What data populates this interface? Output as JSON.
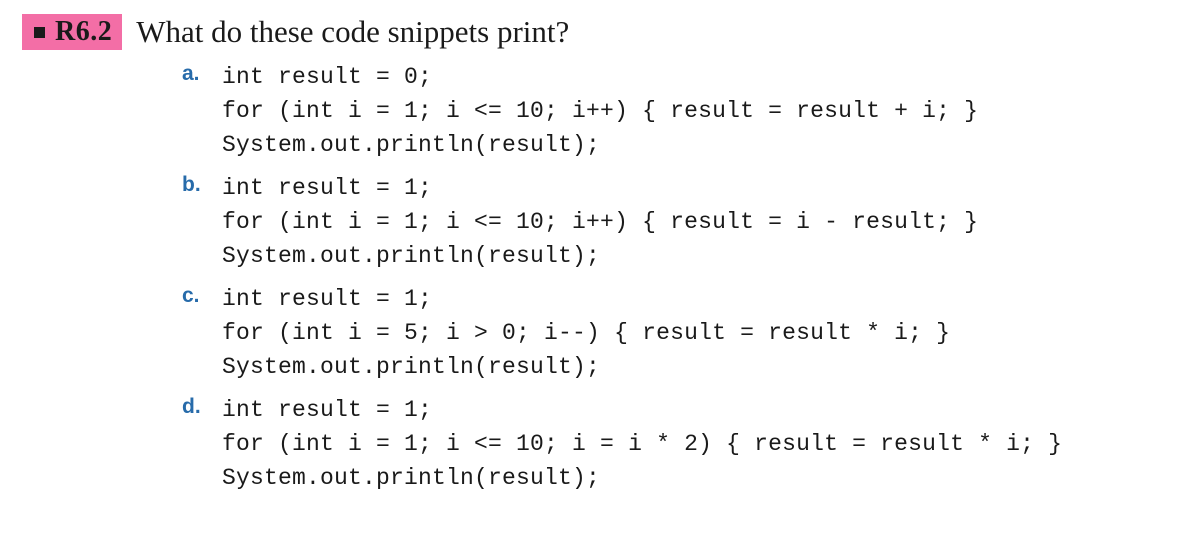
{
  "exercise": {
    "number": "R6.2",
    "question": "What do these code snippets print?",
    "items": [
      {
        "label": "a.",
        "lines": [
          "int result = 0;",
          "for (int i = 1; i <= 10; i++) { result = result + i; }",
          "System.out.println(result);"
        ]
      },
      {
        "label": "b.",
        "lines": [
          "int result = 1;",
          "for (int i = 1; i <= 10; i++) { result = i - result; }",
          "System.out.println(result);"
        ]
      },
      {
        "label": "c.",
        "lines": [
          "int result = 1;",
          "for (int i = 5; i > 0; i--) { result = result * i; }",
          "System.out.println(result);"
        ]
      },
      {
        "label": "d.",
        "lines": [
          "int result = 1;",
          "for (int i = 1; i <= 10; i = i * 2) { result = result * i; }",
          "System.out.println(result);"
        ]
      }
    ]
  }
}
